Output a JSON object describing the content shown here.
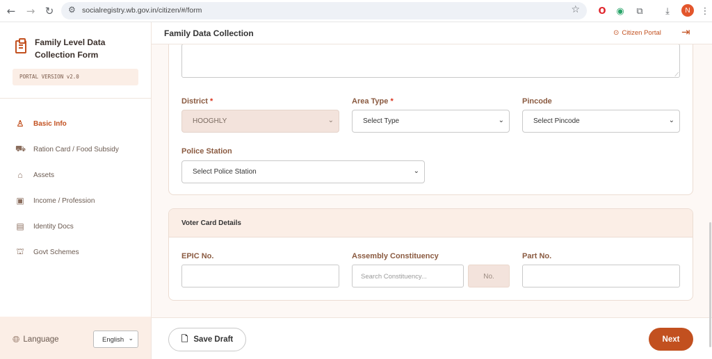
{
  "browser": {
    "url": "socialregistry.wb.gov.in/citizen/#/form",
    "profile_initial": "N"
  },
  "sidebar": {
    "title": "Family Level Data Collection Form",
    "version": "PORTAL VERSION v2.0",
    "items": [
      {
        "label": "Basic Info",
        "icon": "person-icon",
        "active": true
      },
      {
        "label": "Ration Card / Food Subsidy",
        "icon": "cart-icon",
        "active": false
      },
      {
        "label": "Assets",
        "icon": "home-icon",
        "active": false
      },
      {
        "label": "Income / Profession",
        "icon": "money-icon",
        "active": false
      },
      {
        "label": "Identity Docs",
        "icon": "id-card-icon",
        "active": false
      },
      {
        "label": "Govt Schemes",
        "icon": "bank-icon",
        "active": false
      }
    ],
    "language_label": "Language",
    "language_value": "English"
  },
  "header": {
    "title": "Family Data Collection",
    "portal_link": "Citizen Portal"
  },
  "address_section": {
    "district_label": "District",
    "district_value": "HOOGHLY",
    "area_type_label": "Area Type",
    "area_type_value": "Select Type",
    "pincode_label": "Pincode",
    "pincode_value": "Select Pincode",
    "police_station_label": "Police Station",
    "police_station_value": "Select Police Station",
    "required_mark": "*"
  },
  "voter_section": {
    "title": "Voter Card Details",
    "epic_label": "EPIC No.",
    "epic_value": "",
    "assembly_label": "Assembly Constituency",
    "assembly_placeholder": "Search Constituency...",
    "no_button": "No.",
    "part_label": "Part No.",
    "part_value": ""
  },
  "footer": {
    "save_draft": "Save Draft",
    "next": "Next"
  },
  "colors": {
    "accent": "#c2501f",
    "label": "#8a5a40",
    "panel_tint": "#fbeee6"
  }
}
